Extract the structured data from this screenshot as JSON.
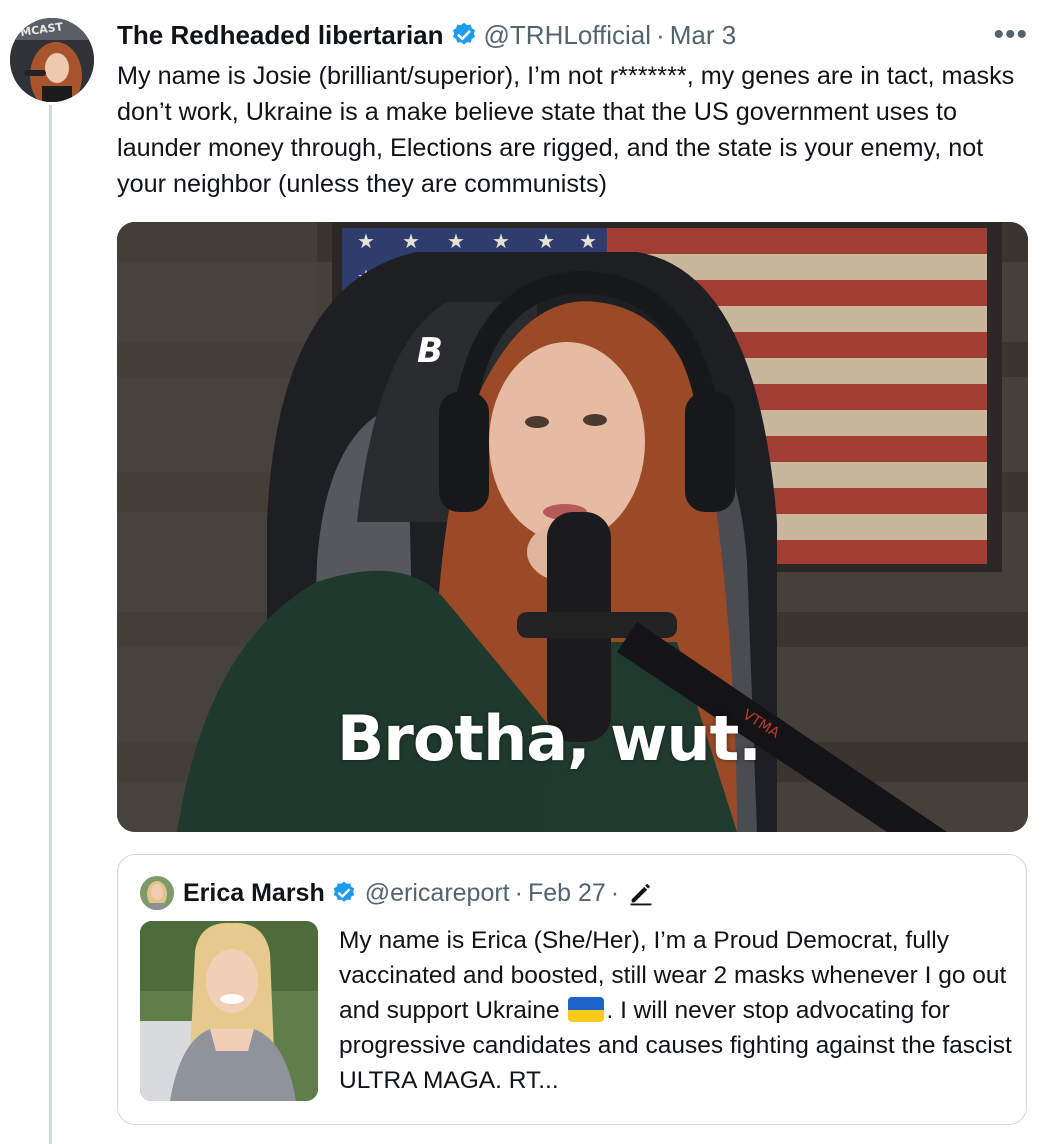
{
  "tweet": {
    "display_name": "The Redheaded libertarian",
    "handle": "@TRHLofficial",
    "separator": "·",
    "date": "Mar 3",
    "more_icon": "more-horizontal-icon",
    "text": "My name is Josie (brilliant/superior), I’m not r*******, my genes are in tact, masks don’t work, Ukraine is a make believe state that the US government uses to launder money through, Elections are rigged, and the state is your enemy, not your neighbor (unless they are communists)",
    "media": {
      "caption": "Brotha, wut.",
      "chair_logo_text": "B",
      "mic_brand_text": "VTMA"
    },
    "avatar_text": "MCAST"
  },
  "quoted_tweet": {
    "display_name": "Erica Marsh",
    "handle": "@ericareport",
    "separator": "·",
    "date": "Feb 27",
    "separator2": "·",
    "edited_icon": "pencil-icon",
    "text_before_flag": "My name is Erica (She/Her), I’m a Proud Democrat, fully vaccinated and boosted, still wear 2 masks whenever I go out and support Ukraine ",
    "flag_icon": "ukraine-flag-emoji",
    "text_after_flag": ". I will never stop advocating for progressive candidates and causes fighting against the fascist ULTRA MAGA. RT..."
  },
  "colors": {
    "verified": "#1d9bf0",
    "muted": "#536471",
    "border": "#cfd9de",
    "text": "#0f1419"
  }
}
